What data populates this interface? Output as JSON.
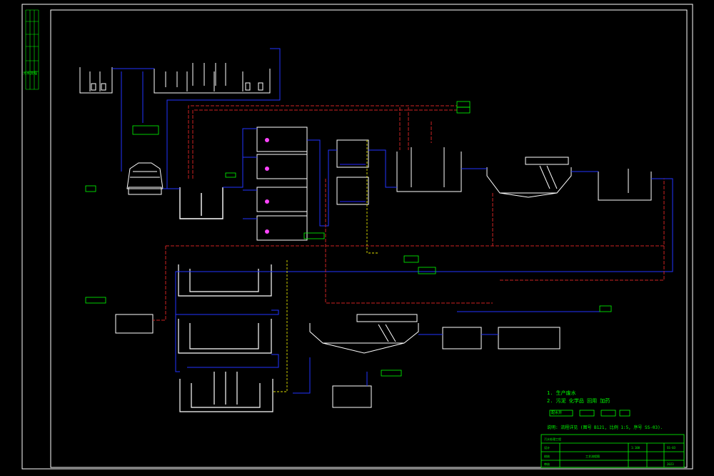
{
  "colors": {
    "background": "#000000",
    "frame": "#ffffff",
    "equipment": "#ffffff",
    "water_line": "#2233ff",
    "sludge_line": "#cc2222",
    "dosing_line": "#e0e000",
    "label": "#00ff00",
    "device": "#ff44ff"
  },
  "notes": {
    "n1": "1. 生产废水",
    "n2": "2. 污泥 化学品 回用 加药",
    "flow_box": "配水井",
    "legend_line": "说明: 流程详见 (图号 B121, 比例 1:5, 序号 SS-03)."
  },
  "title_block": {
    "project": "污水处理工程",
    "drawing_title": "工艺流程图",
    "scale": "1:100",
    "designer": "设计",
    "checker": "校核",
    "approver": "审核",
    "drawing_no": "SS-03",
    "date": "2023"
  },
  "side_labels": [
    "污水流程"
  ]
}
